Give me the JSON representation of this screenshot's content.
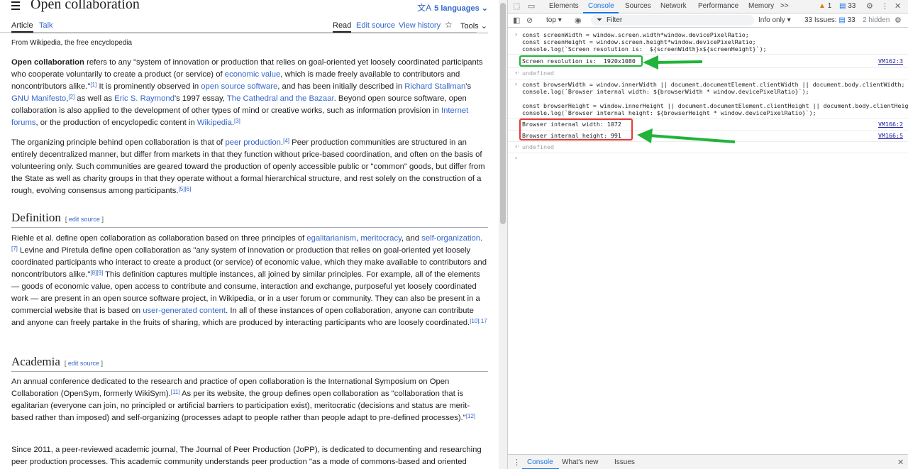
{
  "wiki": {
    "title": "Open collaboration",
    "languages": "5 languages",
    "tabs": {
      "article": "Article",
      "talk": "Talk",
      "read": "Read",
      "edit_source": "Edit source",
      "view_history": "View history",
      "tools": "Tools"
    },
    "from": "From Wikipedia, the free encyclopedia",
    "p1": {
      "a": "Open collaboration",
      "b": " refers to any \"system of innovation or production that relies on goal-oriented yet loosely coordinated participants who cooperate voluntarily to create a product (or service) of ",
      "c": "economic value",
      "d": ", which is made freely available to contributors and noncontributors alike.\"",
      "e": "[1]",
      "f": " It is prominently observed in ",
      "g": "open source software",
      "h": ", and has been initially described in ",
      "i": "Richard Stallman",
      "j": "'s ",
      "k": "GNU Manifesto",
      "l": ",",
      "m": "[2]",
      "n": " as well as ",
      "o": "Eric S. Raymond",
      "p": "'s 1997 essay, ",
      "q": "The Cathedral and the Bazaar",
      "r": ". Beyond open source software, open collaboration is also applied to the development of other types of mind or creative works, such as information provision in ",
      "s": "Internet forums",
      "t": ", or the production of encyclopedic content in ",
      "u": "Wikipedia",
      "v": ".",
      "w": "[3]"
    },
    "p2": {
      "a": "The organizing principle behind open collaboration is that of ",
      "b": "peer production",
      "c": ".",
      "d": "[4]",
      "e": " Peer production communities are structured in an entirely decentralized manner, but differ from markets in that they function without price-based coordination, and often on the basis of volunteering only. Such communities are geared toward the production of openly accessible public or \"common\" goods, but differ from the State as well as charity groups in that they operate without a formal hierarchical structure, and rest solely on the construction of a rough, evolving consensus among participants.",
      "f": "[5][6]"
    },
    "h_definition": "Definition",
    "edit_source_link": "edit source",
    "p3": {
      "a": "Riehle et al. define open collaboration as collaboration based on three principles of ",
      "b": "egalitarianism",
      "c": ", ",
      "d": "meritocracy",
      "e": ", and ",
      "f": "self-organization",
      "g": ".",
      "h": "[7]",
      "i": " Levine and Piretula define open collaboration as \"any system of innovation or production that relies on goal-oriented yet loosely coordinated participants who interact to create a product (or service) of economic value, which they make available to contributors and noncontributors alike.\"",
      "j": "[8][9]",
      "k": " This definition captures multiple instances, all joined by similar principles. For example, all of the elements — goods of economic value, open access to contribute and consume, interaction and exchange, purposeful yet loosely coordinated work — are present in an open source software project, in Wikipedia, or in a user forum or community. They can also be present in a commercial website that is based on ",
      "l": "user-generated content",
      "m": ". In all of these instances of open collaboration, anyone can contribute and anyone can freely partake in the fruits of sharing, which are produced by interacting participants who are loosely coordinated.",
      "n": "[10]:17"
    },
    "h_academia": "Academia",
    "p4": {
      "a": "An annual conference dedicated to the research and practice of open collaboration is the International Symposium on Open Collaboration (OpenSym, formerly WikiSym).",
      "b": "[11]",
      "c": " As per its website, the group defines open collaboration as \"collaboration that is egalitarian (everyone can join, no principled or artificial barriers to participation exist), meritocratic (decisions and status are merit-based rather than imposed) and self-organizing (processes adapt to people rather than people adapt to pre-defined processes).\"",
      "d": "[12]"
    },
    "p5": "Since 2011, a peer-reviewed academic journal, The Journal of Peer Production (JoPP), is dedicated to documenting and researching peer production processes. This academic community understands peer production \"as a mode of commons-based and oriented"
  },
  "devtools": {
    "tabs": [
      "Elements",
      "Console",
      "Sources",
      "Network",
      "Performance",
      "Memory"
    ],
    "more_tabs": ">>",
    "warnings": "1",
    "messages": "33",
    "context": "top",
    "filter_placeholder": "Filter",
    "level": "Info only",
    "issues_label": "33 Issues:",
    "issues_count": "33",
    "hidden": "2 hidden",
    "code1": {
      "l1": "const screenWidth = window.screen.width*window.devicePixelRatio;",
      "l2": "const screenHeight = window.screen.height*window.devicePixelRatio;",
      "l3": "console.log(`Screen resolution is:  ${screenWidth}x${screenHeight}`);"
    },
    "out1": "Screen resolution is:  1920x1080",
    "src1": "VM162:3",
    "undefined": "undefined",
    "code2": {
      "l1": "const browserWidth = window.innerWidth || document.documentElement.clientWidth || document.body.clientWidth;",
      "l2": "console.log(`Browser internal width: ${browserWidth * window.devicePixelRatio}`);",
      "l3": "const browserHeight = window.innerHeight || document.documentElement.clientHeight || document.body.clientHeight;",
      "l4": "console.log(`Browser internal height: ${browserHeight * window.devicePixelRatio}`);"
    },
    "out2": "Browser internal width: 1072",
    "src2": "VM166:2",
    "out3": "Browser internal height: 991",
    "src3": "VM166:5",
    "drawer_tabs": [
      "Console",
      "What's new",
      "Issues"
    ],
    "colors": {
      "green_highlight": "#22b33a",
      "red_highlight": "#e53935",
      "accent": "#1a73e8"
    }
  }
}
